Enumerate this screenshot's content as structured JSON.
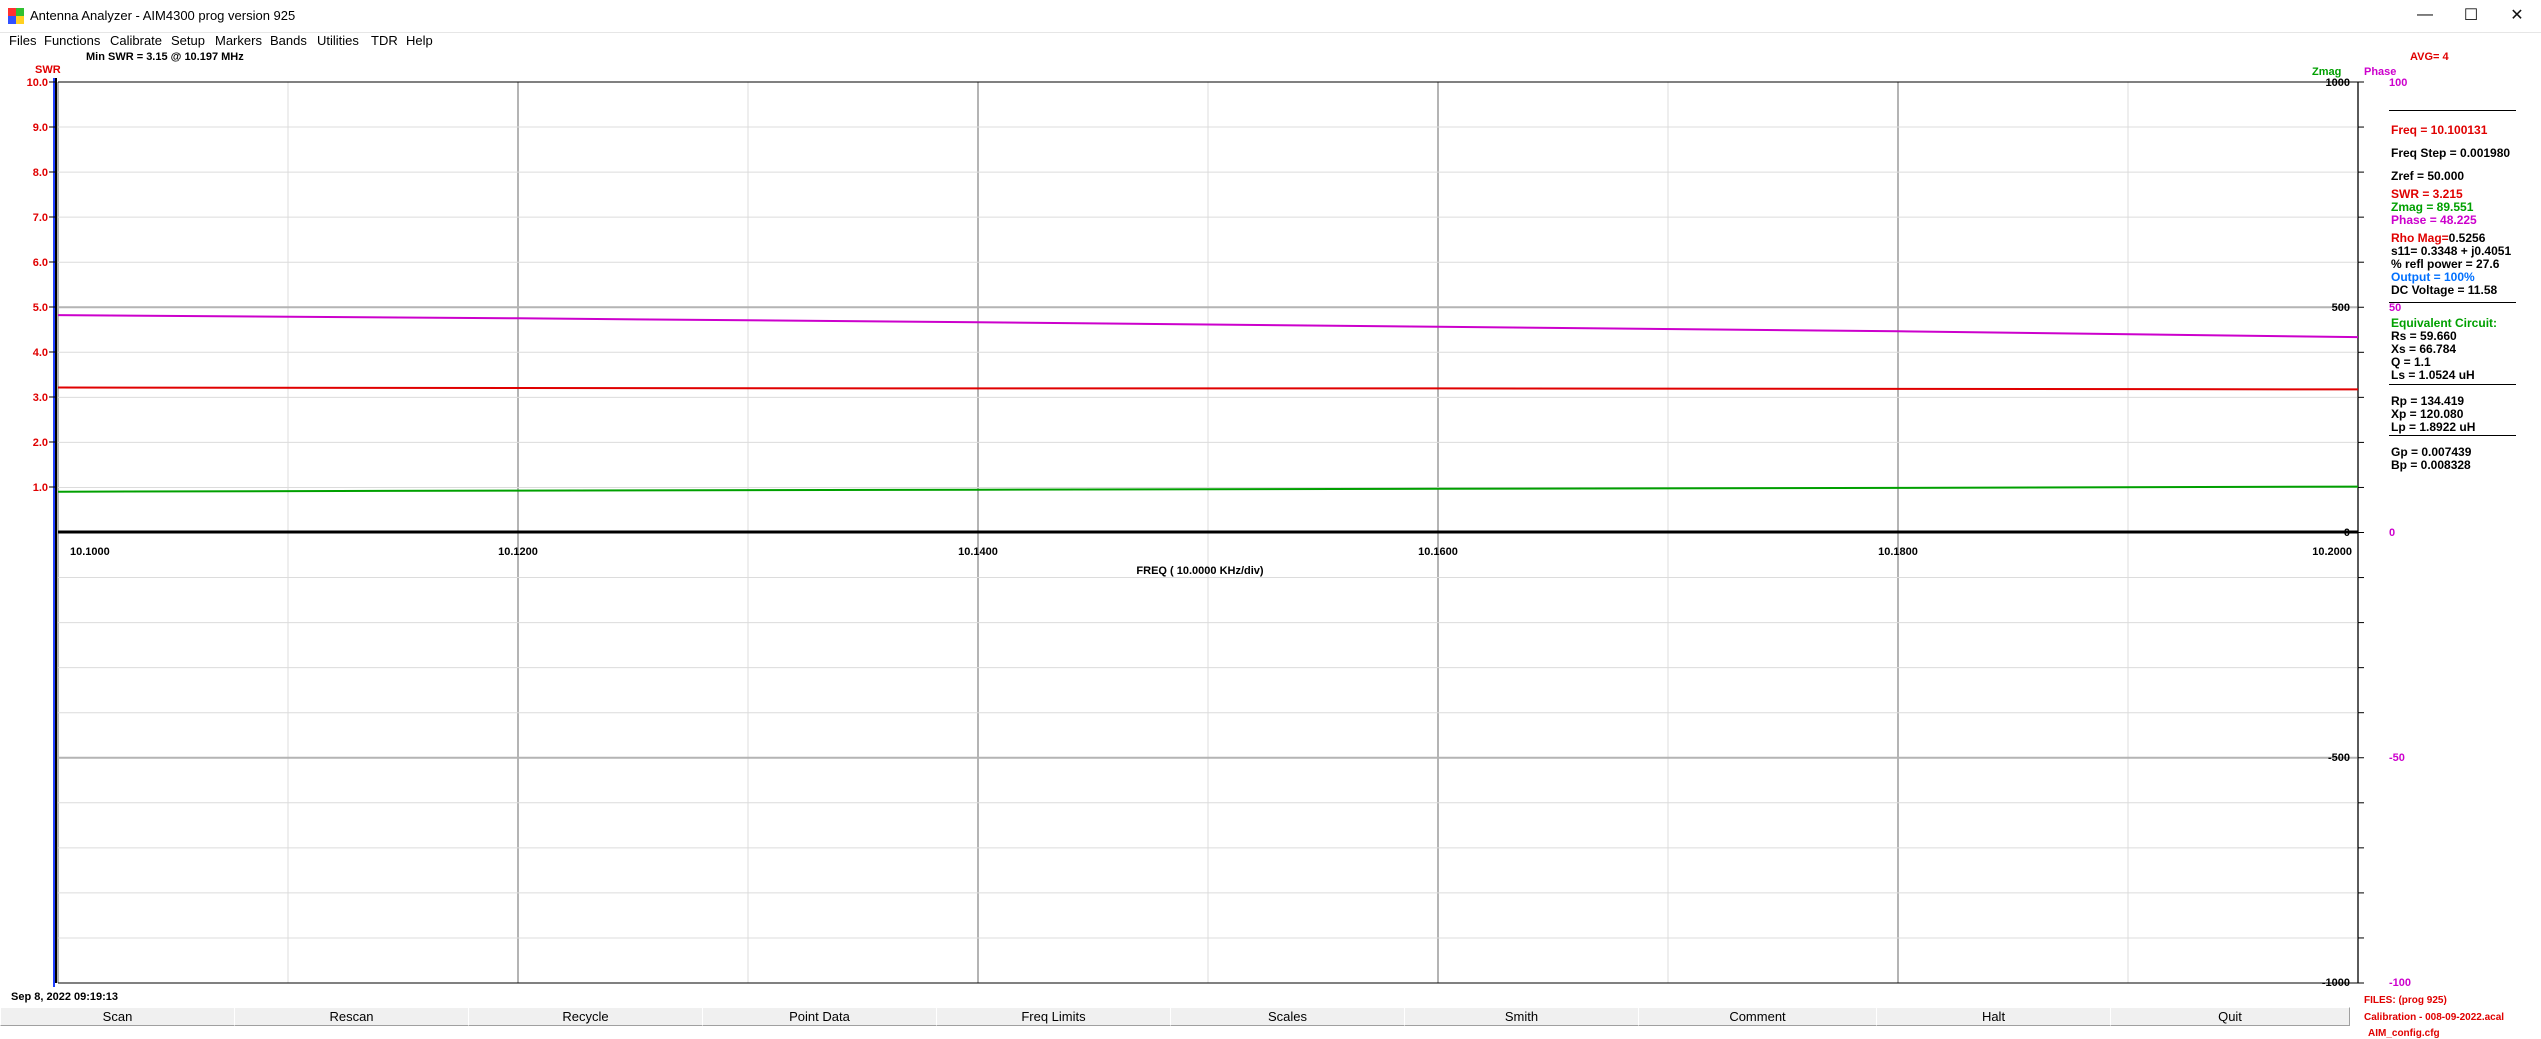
{
  "window": {
    "title": "Antenna Analyzer -  AIM4300    prog version 925",
    "minimize_glyph": "—",
    "maximize_glyph": "☐",
    "close_glyph": "✕"
  },
  "menu": [
    "Files",
    "Functions",
    "Calibrate",
    "Setup",
    "Markers",
    "Bands",
    "Utilities",
    "TDR",
    "Help"
  ],
  "header": {
    "swr_label": "SWR",
    "min_swr": "Min SWR =    3.15  @   10.197  MHz",
    "zmag_label": "Zmag",
    "phase_label": "Phase",
    "avg": "AVG=  4"
  },
  "readout": {
    "freq": "Freq = 10.100131",
    "freq_step": "Freq Step = 0.001980",
    "zref": "Zref =    50.000",
    "swr": "SWR =     3.215",
    "zmag": "Zmag =    89.551",
    "phase": "Phase =    48.225",
    "rho_label": "Rho Mag=",
    "rho_value": "0.5256",
    "s11": "s11= 0.3348 + j0.4051",
    "refl_power": "% refl power = 27.6",
    "output_label": "Output =  100%",
    "dc_voltage": "DC Voltage =  11.58",
    "eq_title": "Equivalent Circuit:",
    "rs": "Rs =    59.660",
    "xs": "Xs =    66.784",
    "q": "Q =    1.1",
    "ls": "Ls =     1.0524  uH",
    "rp": "Rp =   134.419",
    "xp": "Xp =   120.080",
    "lp": "Lp =     1.8922  uH",
    "gp": "Gp =   0.007439",
    "bp": "Bp =   0.008328"
  },
  "footer": {
    "timestamp": "Sep 8, 2022  09:19:13",
    "files_label": "FILES:  (prog 925)",
    "calibration": "Calibration - 008-09-2022.acal",
    "config": "AIM_config.cfg"
  },
  "buttons": [
    "Scan",
    "Rescan",
    "Recycle",
    "Point Data",
    "Freq Limits",
    "Scales",
    "Smith",
    "Comment",
    "Halt",
    "Quit"
  ],
  "colors": {
    "swr": "#e00000",
    "zmag": "#00a000",
    "phase": "#cc00cc",
    "output": "#0070ff",
    "grid_major": "#b4b4b4",
    "grid_minor": "#dcdcdc"
  },
  "chart_data": {
    "type": "line",
    "xlabel": "FREQ (  10.0000 KHz/div)",
    "x_ticks": [
      "10.1000",
      "10.1200",
      "10.1400",
      "10.1600",
      "10.1800",
      "10.2000"
    ],
    "xlim": [
      10.1,
      10.2
    ],
    "swr_axis": {
      "label": "SWR",
      "ticks": [
        "10.0",
        "9.0",
        "8.0",
        "7.0",
        "6.0",
        "5.0",
        "4.0",
        "3.0",
        "2.0",
        "1.0"
      ],
      "ylim": [
        0,
        10
      ]
    },
    "zmag_axis": {
      "label": "Zmag",
      "ticks": [
        "1000",
        "500",
        "0",
        "-500",
        "-1000"
      ],
      "ylim": [
        -1000,
        1000
      ]
    },
    "phase_axis": {
      "label": "Phase",
      "ticks": [
        "100",
        "50",
        "0",
        "-50",
        "-100"
      ],
      "ylim": [
        -100,
        100
      ]
    },
    "series": [
      {
        "name": "SWR",
        "axis": "swr",
        "color": "#e00000",
        "x": [
          10.1,
          10.12,
          10.14,
          10.16,
          10.18,
          10.2
        ],
        "y": [
          3.21,
          3.2,
          3.19,
          3.19,
          3.18,
          3.17
        ]
      },
      {
        "name": "Zmag",
        "axis": "zmag",
        "color": "#00a000",
        "x": [
          10.1,
          10.12,
          10.14,
          10.16,
          10.18,
          10.2
        ],
        "y": [
          89.5,
          92,
          94,
          96,
          98,
          101
        ]
      },
      {
        "name": "Phase",
        "axis": "phase",
        "color": "#cc00cc",
        "x": [
          10.1,
          10.12,
          10.14,
          10.16,
          10.18,
          10.2
        ],
        "y": [
          48.2,
          47.5,
          46.6,
          45.6,
          44.6,
          43.3
        ]
      }
    ]
  }
}
